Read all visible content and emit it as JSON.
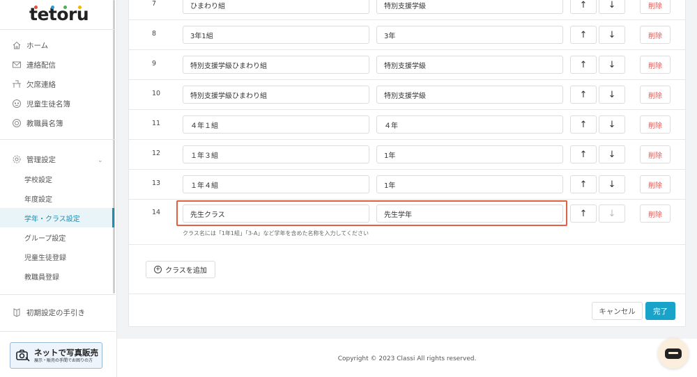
{
  "app": {
    "logo_text": "tetoru",
    "logo_dot_colors": [
      "#e94b3c",
      "#2c9bd6",
      "#4caf50",
      "#f5b400"
    ]
  },
  "sidebar": {
    "nav": [
      {
        "label": "ホーム",
        "icon": "home-icon"
      },
      {
        "label": "連絡配信",
        "icon": "mail-icon"
      },
      {
        "label": "欠席連絡",
        "icon": "desk-icon"
      },
      {
        "label": "児童生徒名簿",
        "icon": "student-icon"
      },
      {
        "label": "教職員名簿",
        "icon": "teacher-icon"
      }
    ],
    "settings": {
      "label": "管理設定",
      "icon": "gear-icon"
    },
    "sub_items": [
      {
        "label": "学校設定"
      },
      {
        "label": "年度設定"
      },
      {
        "label": "学年・クラス設定",
        "active": true
      },
      {
        "label": "グループ設定"
      },
      {
        "label": "児童生徒登録"
      },
      {
        "label": "教職員登録"
      }
    ],
    "guide": {
      "label": "初期設定の手引き",
      "icon": "book-icon"
    },
    "promo": {
      "title": "ネットで写真販売",
      "subtitle": "展示・販売の手間でお困りの方",
      "icon": "photo-icon"
    }
  },
  "classes": [
    {
      "num": "7",
      "name": "ひまわり組",
      "grade": "特別支援学級"
    },
    {
      "num": "8",
      "name": "3年1組",
      "grade": "3年"
    },
    {
      "num": "9",
      "name": "特別支援学級ひまわり組",
      "grade": "特別支援学級"
    },
    {
      "num": "10",
      "name": "特別支援学級ひまわり組",
      "grade": "特別支援学級"
    },
    {
      "num": "11",
      "name": "４年１組",
      "grade": "４年"
    },
    {
      "num": "12",
      "name": "１年３組",
      "grade": "1年"
    },
    {
      "num": "13",
      "name": "１年４組",
      "grade": "1年"
    },
    {
      "num": "14",
      "name": "先生クラス",
      "grade": "先生学年"
    }
  ],
  "buttons": {
    "up": "↑",
    "down": "↓",
    "delete": "削除",
    "add_class": "クラスを追加",
    "cancel": "キャンセル",
    "done": "完了"
  },
  "hint": "クラス名には「1年1組」「3-A」など学年を含めた名称を入力してください",
  "colors": {
    "accent": "#1aa3c9",
    "delete": "#e05c58",
    "highlight": "#e0603f"
  },
  "footer": {
    "copyright": "Copyright © 2023 Classi All rights reserved."
  }
}
